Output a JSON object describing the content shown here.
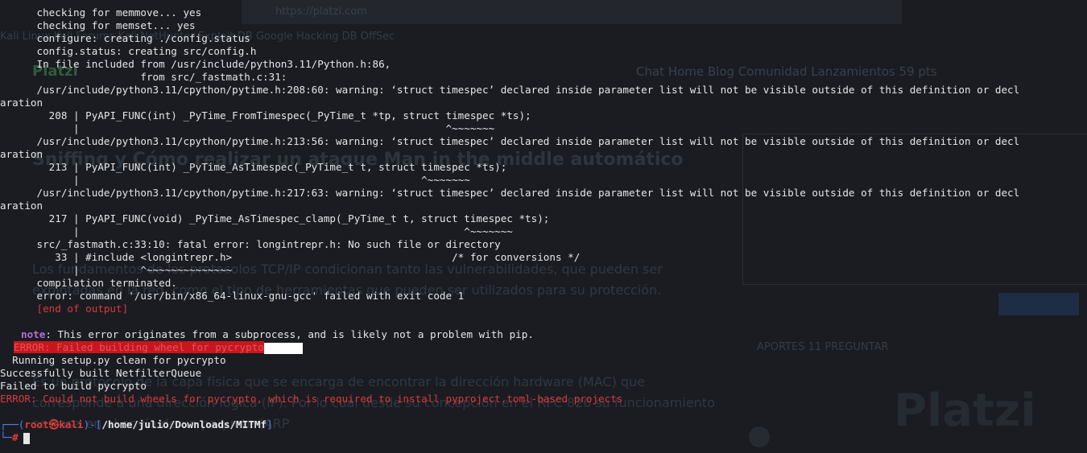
{
  "background": {
    "url": "https://platzi.com",
    "bookmarks": "Kali Linux   Kali Forums   Kali NetHunter   Exploit-DB   Google Hacking DB   OffSec",
    "logo": "Platzi",
    "nav": "Chat   Home   Blog   Comunidad   Lanzamientos   59 pts",
    "title": "Sniffing y Cómo realizar un ataque Man in the middle automático",
    "para": "Los fundamentos de los protocolos TCP/IP condicionan tanto las vulnerabilidades, que pueden ser explotadas en la red, como el tipo de herramientas que pueden ser utilizados para su protección.",
    "para2": "Es un protocolo de la capa física que se encarga de encontrar la dirección hardware (MAC) que corresponde a una dirección lógica (IP). Por lo cual desde su concepción en el RFC 826 su funcionamiento se basa en el envío de un paquete (ARP",
    "tabs": "APORTES 11        PREGUNTAR",
    "watermark": "Platzi"
  },
  "terminal": {
    "lines": [
      "      checking for memmove... yes",
      "      checking for memset... yes",
      "      configure: creating ./config.status",
      "      config.status: creating src/config.h",
      "      In file included from /usr/include/python3.11/Python.h:86,",
      "                       from src/_fastmath.c:31:",
      "      /usr/include/python3.11/cpython/pytime.h:208:60: warning: ‘struct timespec’ declared inside parameter list will not be visible outside of this definition or decl",
      "aration",
      "        208 | PyAPI_FUNC(int) _PyTime_FromTimespec(_PyTime_t *tp, struct timespec *ts);",
      "            |                                                            ^~~~~~~~",
      "      /usr/include/python3.11/cpython/pytime.h:213:56: warning: ‘struct timespec’ declared inside parameter list will not be visible outside of this definition or decl",
      "aration",
      "        213 | PyAPI_FUNC(int) _PyTime_AsTimespec(_PyTime_t t, struct timespec *ts);",
      "            |                                                        ^~~~~~~~",
      "      /usr/include/python3.11/cpython/pytime.h:217:63: warning: ‘struct timespec’ declared inside parameter list will not be visible outside of this definition or decl",
      "aration",
      "        217 | PyAPI_FUNC(void) _PyTime_AsTimespec_clamp(_PyTime_t t, struct timespec *ts);",
      "            |                                                               ^~~~~~~~",
      "      src/_fastmath.c:33:10: fatal error: longintrepr.h: No such file or directory",
      "         33 | #include <longintrepr.h>                                    /* for conversions */",
      "            |          ^~~~~~~~~~~~~~~",
      "      compilation terminated.",
      "      error: command '/usr/bin/x86_64-linux-gnu-gcc' failed with exit code 1"
    ],
    "end_of_output": "      [end of output]",
    "note_label": "note",
    "note_text": ": This error originates from a subprocess, and is likely not a problem with pip.",
    "error_wheel": "ERROR: Failed building wheel for pycrypto",
    "running_setup": "  Running setup.py clean for pycrypto",
    "success_built": "Successfully built NetfilterQueue",
    "failed_build": "Failed to build pycrypto",
    "error_final": "ERROR: Could not build wheels for pycrypto, which is required to install pyproject.toml-based projects",
    "prompt": {
      "corner_top": "┌──(",
      "user": "root㉿kali",
      "mid": ")-[",
      "path": "/home/julio/Downloads/MITMf",
      "close": "]",
      "corner_bottom": "└─",
      "symbol": "#"
    }
  },
  "colors": {
    "background": "#1a1c22",
    "text": "#e6e6e6",
    "error": "#d83a3a",
    "note": "#b36fd8",
    "prompt_blue": "#4f7ff0"
  }
}
